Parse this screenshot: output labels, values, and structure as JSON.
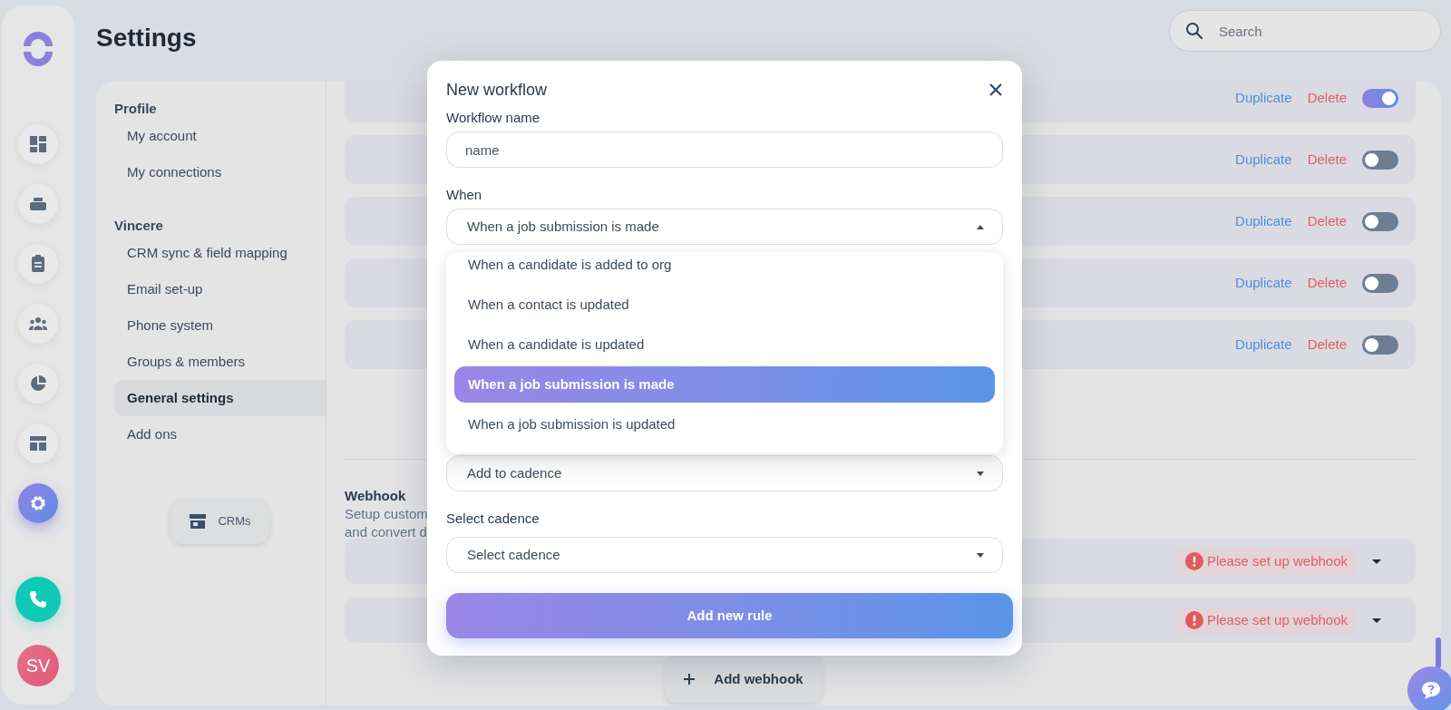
{
  "rail": {
    "items": [
      {
        "kind": "dashboard",
        "selected": false
      },
      {
        "kind": "stack",
        "selected": false
      },
      {
        "kind": "clipboard",
        "selected": false
      },
      {
        "kind": "people",
        "selected": false
      },
      {
        "kind": "pie",
        "selected": false
      },
      {
        "kind": "layout",
        "selected": false
      },
      {
        "kind": "settings",
        "selected": true
      }
    ],
    "avatar": {
      "initials": "SV"
    }
  },
  "title": "Settings",
  "search": {
    "placeholder": "Search"
  },
  "settings_nav": {
    "groups": [
      {
        "heading": "Profile",
        "items": [
          {
            "label": "My account",
            "selected": false
          },
          {
            "label": "My connections",
            "selected": false
          }
        ]
      },
      {
        "heading": "Vincere",
        "items": [
          {
            "label": "CRM sync & field mapping",
            "selected": false
          },
          {
            "label": "Email set-up",
            "selected": false
          },
          {
            "label": "Phone system",
            "selected": false
          },
          {
            "label": "Groups & members",
            "selected": false
          },
          {
            "label": "General settings",
            "selected": true
          },
          {
            "label": "Add ons",
            "selected": false
          }
        ]
      }
    ],
    "crms_button": "CRMs"
  },
  "workflows": [
    {
      "duplicate": "Duplicate",
      "delete": "Delete",
      "on": true
    },
    {
      "duplicate": "Duplicate",
      "delete": "Delete",
      "on": false
    },
    {
      "duplicate": "Duplicate",
      "delete": "Delete",
      "on": false
    },
    {
      "duplicate": "Duplicate",
      "delete": "Delete",
      "on": false
    },
    {
      "duplicate": "Duplicate",
      "delete": "Delete",
      "on": false
    }
  ],
  "webhook": {
    "title": "Webhook",
    "description_lines": [
      "Setup custom",
      "and convert d"
    ],
    "rows": [
      {
        "status": "Please set up webhook"
      },
      {
        "status": "Please set up webhook"
      }
    ],
    "add_button": "Add webhook"
  },
  "modal": {
    "title": "New workflow",
    "name_field": {
      "label": "Workflow name",
      "placeholder": "name"
    },
    "when_field": {
      "label": "When",
      "value": "When a job submission is made",
      "expanded": true,
      "options": [
        {
          "label": "When a candidate is added to org",
          "selected": false
        },
        {
          "label": "When a contact is updated",
          "selected": false
        },
        {
          "label": "When a candidate is updated",
          "selected": false
        },
        {
          "label": "When a job submission is made",
          "selected": true
        },
        {
          "label": "When a job submission is updated",
          "selected": false
        }
      ]
    },
    "action_field": {
      "value": "Add to cadence"
    },
    "cadence_field": {
      "label": "Select cadence",
      "placeholder": "Select cadence"
    },
    "submit": "Add new rule"
  }
}
